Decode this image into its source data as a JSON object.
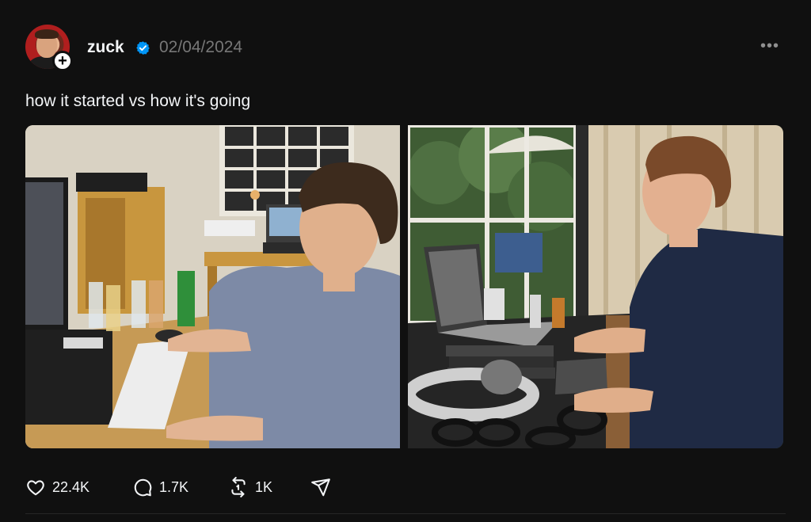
{
  "post": {
    "username": "zuck",
    "date": "02/04/2024",
    "follow_symbol": "+",
    "more_symbol": "•••",
    "caption": "how it started vs how it's going",
    "images": [
      {
        "name": "then-photo"
      },
      {
        "name": "now-photo"
      }
    ],
    "actions": {
      "likes": "22.4K",
      "comments": "1.7K",
      "reposts": "1K"
    }
  },
  "colors": {
    "background": "#101010",
    "text": "#f3f5f7",
    "muted": "#777777",
    "verified": "#0095f6"
  },
  "icons": [
    "heart-icon",
    "comment-icon",
    "repost-icon",
    "share-icon",
    "verified-icon",
    "more-icon",
    "follow-plus-icon"
  ]
}
